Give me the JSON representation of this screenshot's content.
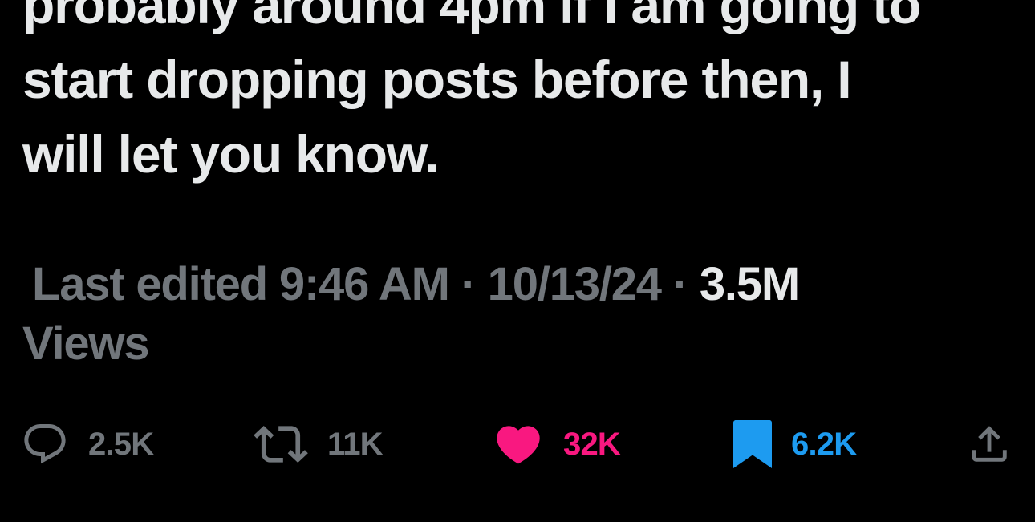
{
  "tweet": {
    "text_lines": [
      "probably around 4pm if I am going to",
      "start dropping posts before then, I",
      "will let you know."
    ]
  },
  "meta": {
    "edited_prefix": "Last edited 9:46 AM · 10/13/24",
    "separator": "·",
    "views_count": "3.5M",
    "views_label": "Views"
  },
  "actions": {
    "reply_count": "2.5K",
    "retweet_count": "11K",
    "like_count": "32K",
    "bookmark_count": "6.2K"
  },
  "colors": {
    "background": "#000000",
    "text_primary": "#e7e9ea",
    "text_secondary": "#71767b",
    "like_active": "#f91880",
    "bookmark_active": "#1d9bf0"
  },
  "icons": [
    "reply-icon",
    "retweet-icon",
    "like-icon",
    "bookmark-icon",
    "share-icon"
  ]
}
